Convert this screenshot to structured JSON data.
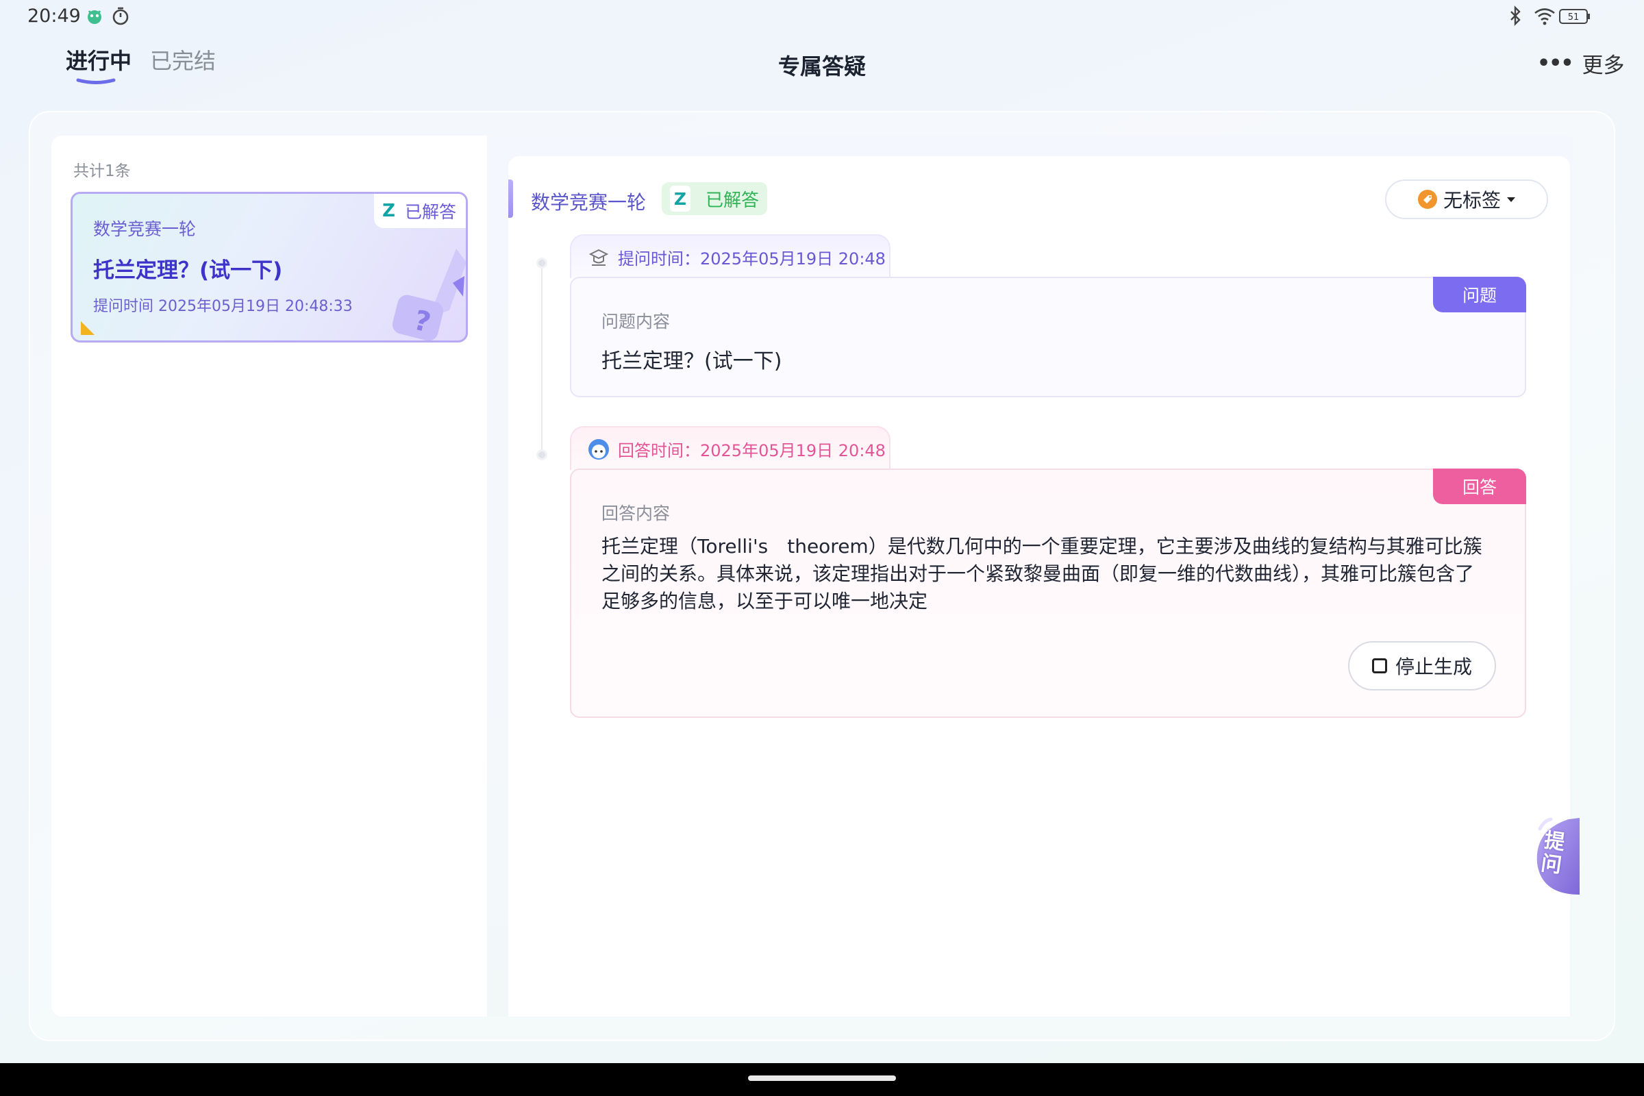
{
  "status_bar": {
    "time": "20:49",
    "battery": "51",
    "icons": [
      "app-notification-icon",
      "stopwatch-icon",
      "bluetooth-icon",
      "wifi-icon",
      "battery-icon"
    ]
  },
  "header": {
    "tabs": [
      {
        "label": "进行中",
        "active": true
      },
      {
        "label": "已完结",
        "active": false
      }
    ],
    "title": "专属答疑",
    "more_label": "更多",
    "more_icon": "more-dots-icon"
  },
  "list": {
    "count_label": "共计1条",
    "items": [
      {
        "status_icon": "Z",
        "status": "已解答",
        "subject": "数学竞赛一轮",
        "title": "托兰定理？(试一下)",
        "time": "提问时间 2025年05月19日 20:48:33"
      }
    ]
  },
  "detail": {
    "subject": "数学竞赛一轮",
    "status_icon": "Z",
    "status": "已解答",
    "tag_label": "无标签",
    "question": {
      "time": "提问时间：2025年05月19日 20:48",
      "flag": "问题",
      "label": "问题内容",
      "content": "托兰定理？(试一下)"
    },
    "answer": {
      "time": "回答时间：2025年05月19日 20:48",
      "flag": "回答",
      "label": "回答内容",
      "content": "托兰定理（Torelli's　theorem）是代数几何中的一个重要定理，它主要涉及曲线的复结构与其雅可比簇之间的关系。具体来说，该定理指出对于一个紧致黎曼曲面（即复一维的代数曲线），其雅可比簇包含了足够多的信息，以至于可以唯一地决定",
      "stop_label": "停止生成"
    }
  },
  "float_ask": {
    "label": "提问"
  },
  "colors": {
    "accent_purple": "#6a5ed2",
    "question_flag": "#7b6cf0",
    "answer_flag": "#ee5fa0",
    "solved_green": "#2fb455"
  }
}
